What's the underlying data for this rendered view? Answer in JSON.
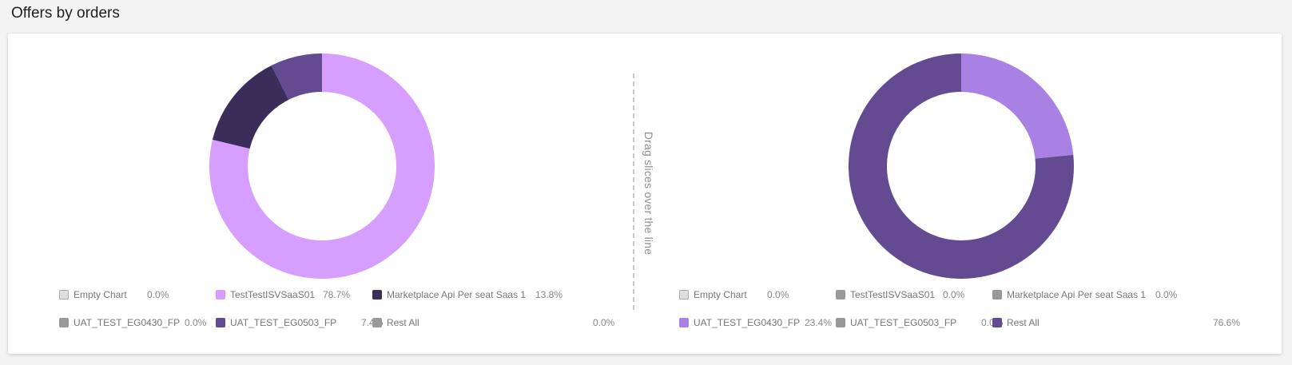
{
  "title": "Offers by orders",
  "drag_hint": "Drag slices over the line",
  "colors": {
    "TestTestISVSaaS01": "#d69eff",
    "Marketplace Api Per seat Saas 1": "#3b2d5a",
    "UAT_TEST_EG0503_FP": "#634a91",
    "UAT_TEST_EG0430_FP": "#a980e3",
    "Rest All": "#634a91",
    "inactive": "#999999",
    "empty": "#e0e0e0"
  },
  "chart_data": [
    {
      "type": "pie",
      "donut": true,
      "slices": [
        {
          "label": "Empty Chart",
          "value": 0.0,
          "display": "0.0%",
          "color": "#e0e0e0"
        },
        {
          "label": "TestTestISVSaaS01",
          "value": 78.7,
          "display": "78.7%",
          "color": "#d69eff"
        },
        {
          "label": "Marketplace Api Per seat Saas 1",
          "value": 13.8,
          "display": "13.8%",
          "color": "#3b2d5a"
        },
        {
          "label": "UAT_TEST_EG0430_FP",
          "value": 0.0,
          "display": "0.0%",
          "color": "#999999"
        },
        {
          "label": "UAT_TEST_EG0503_FP",
          "value": 7.4,
          "display": "7.4%",
          "color": "#634a91"
        },
        {
          "label": "Rest All",
          "value": 0.0,
          "display": "0.0%",
          "color": "#999999"
        }
      ]
    },
    {
      "type": "pie",
      "donut": true,
      "slices": [
        {
          "label": "Empty Chart",
          "value": 0.0,
          "display": "0.0%",
          "color": "#e0e0e0"
        },
        {
          "label": "TestTestISVSaaS01",
          "value": 0.0,
          "display": "0.0%",
          "color": "#999999"
        },
        {
          "label": "Marketplace Api Per seat Saas 1",
          "value": 0.0,
          "display": "0.0%",
          "color": "#999999"
        },
        {
          "label": "UAT_TEST_EG0430_FP",
          "value": 23.4,
          "display": "23.4%",
          "color": "#a980e3"
        },
        {
          "label": "UAT_TEST_EG0503_FP",
          "value": 0.0,
          "display": "0.0%",
          "color": "#999999"
        },
        {
          "label": "Rest All",
          "value": 76.6,
          "display": "76.6%",
          "color": "#634a91"
        }
      ]
    }
  ]
}
